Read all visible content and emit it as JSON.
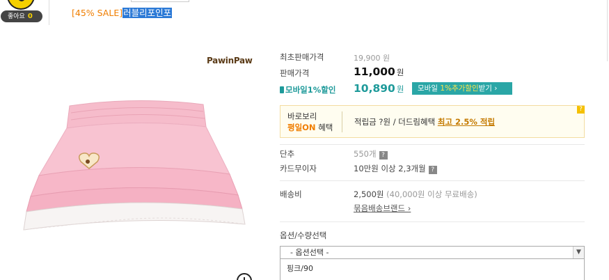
{
  "header": {
    "like_label": "좋아요",
    "like_count": "0",
    "sale_prefix": "[45% SALE]",
    "sale_highlight": "러블리포인포"
  },
  "product": {
    "brand_logo": "PawinPaw",
    "image_alt": "pink ruffle skirt"
  },
  "pricing": {
    "original_label": "최초판매가격",
    "original_value": "19,900 원",
    "sale_label": "판매가격",
    "sale_value": "11,000",
    "sale_unit": "원",
    "mobile_label": "모바일1%할인",
    "mobile_value": "10,890",
    "mobile_unit": "원",
    "mobile_button_prefix": "모바일 ",
    "mobile_button_highlight": "1%추가할인",
    "mobile_button_suffix": "받기 ›"
  },
  "benefit": {
    "line1": "바로보리",
    "line2_orange": "평일ON",
    "line2_rest": " 혜택",
    "text": "적립금 ?원 / 더드림혜택 ",
    "link": "최고 2.5% 적립",
    "q": "?"
  },
  "details": {
    "unit_label": "단추",
    "unit_value": "550개",
    "card_label": "카드무이자",
    "card_value": "10만원 이상 2,3개월",
    "ship_label": "배송비",
    "ship_value": "2,500원",
    "ship_note": "(40,000원 이상 무료배송)",
    "bundle_link": "묶음배송브랜드 ›",
    "q": "?"
  },
  "options": {
    "title": "옵션/수량선택",
    "select_value": "- 옵션선택 -",
    "items": [
      "핑크/90"
    ]
  },
  "colors": {
    "accent_teal": "#2aa6a6",
    "sale_orange": "#f07e00",
    "highlight_blue": "#2b79d6"
  }
}
